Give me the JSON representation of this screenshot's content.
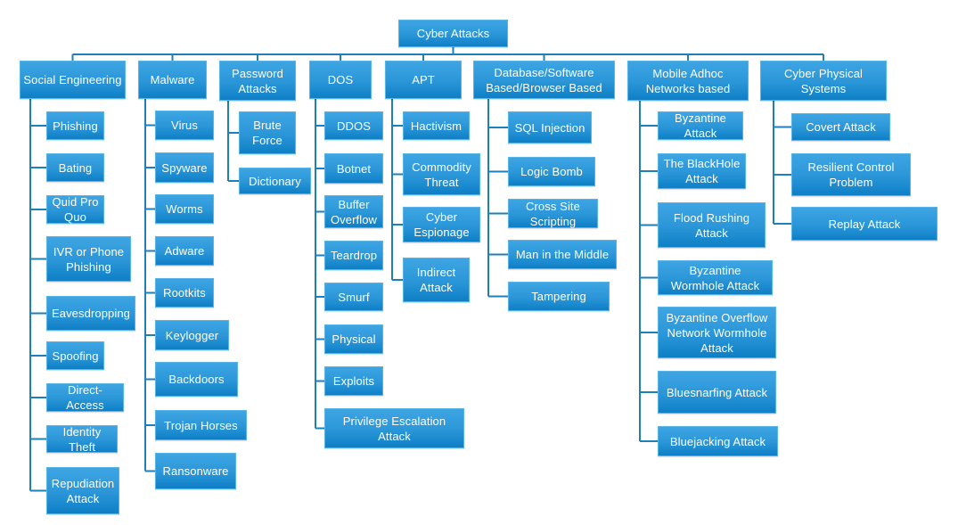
{
  "diagram": {
    "root": {
      "label": "Cyber Attacks"
    },
    "colors": {
      "box_top": "#3ea5e3",
      "box_bottom": "#0e7fc6",
      "connector": "#1f7fb8",
      "text": "#ffffff"
    },
    "categories": [
      {
        "id": "social",
        "label": "Social Engineering",
        "children": [
          "Phishing",
          "Bating",
          "Quid Pro\nQuo",
          "IVR or Phone\nPhishing",
          "Eavesdropping",
          "Spoofing",
          "Direct-Access",
          "Identity\nTheft",
          "Repudiation\nAttack"
        ]
      },
      {
        "id": "malware",
        "label": "Malware",
        "children": [
          "Virus",
          "Spyware",
          "Worms",
          "Adware",
          "Rootkits",
          "Keylogger",
          "Backdoors",
          "Trojan Horses",
          "Ransonware"
        ]
      },
      {
        "id": "password",
        "label": "Password\nAttacks",
        "children": [
          "Brute\nForce",
          "Dictionary"
        ]
      },
      {
        "id": "dos",
        "label": "DOS",
        "children": [
          "DDOS",
          "Botnet",
          "Buffer\nOverflow",
          "Teardrop",
          "Smurf",
          "Physical",
          "Exploits",
          "Privilege Escalation\nAttack"
        ]
      },
      {
        "id": "apt",
        "label": "APT",
        "children": [
          "Hactivism",
          "Commodity\nThreat",
          "Cyber\nEspionage",
          "Indirect\nAttack"
        ]
      },
      {
        "id": "database",
        "label": "Database/Software\nBased/Browser Based",
        "children": [
          "SQL Injection",
          "Logic Bomb",
          "Cross Site\nScripting",
          "Man in the Middle",
          "Tampering"
        ]
      },
      {
        "id": "manet",
        "label": "Mobile Adhoc\nNetworks based",
        "children": [
          "Byzantine\nAttack",
          "The BlackHole\nAttack",
          "Flood Rushing\nAttack",
          "Byzantine\nWormhole Attack",
          "Byzantine Overflow\nNetwork Wormhole\nAttack",
          "Bluesnarfing Attack",
          "Bluejacking Attack"
        ]
      },
      {
        "id": "cps",
        "label": "Cyber Physical\nSystems",
        "children": [
          "Covert Attack",
          "Resilient Control\nProblem",
          "Replay Attack"
        ]
      }
    ]
  }
}
